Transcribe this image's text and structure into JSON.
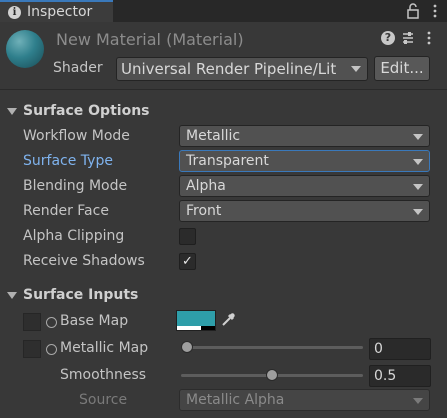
{
  "tab": {
    "label": "Inspector",
    "icon": "info-icon"
  },
  "header": {
    "title": "New Material (Material)",
    "shader_label": "Shader",
    "shader_value": "Universal Render Pipeline/Lit",
    "edit_label": "Edit..."
  },
  "surface_options": {
    "title": "Surface Options",
    "workflow_mode": {
      "label": "Workflow Mode",
      "value": "Metallic"
    },
    "surface_type": {
      "label": "Surface Type",
      "value": "Transparent"
    },
    "blending_mode": {
      "label": "Blending Mode",
      "value": "Alpha"
    },
    "render_face": {
      "label": "Render Face",
      "value": "Front"
    },
    "alpha_clipping": {
      "label": "Alpha Clipping",
      "checked": false
    },
    "receive_shadows": {
      "label": "Receive Shadows",
      "checked": true,
      "check_glyph": "✓"
    }
  },
  "surface_inputs": {
    "title": "Surface Inputs",
    "base_map": {
      "label": "Base Map",
      "color": "#2e9ea9"
    },
    "metallic_map": {
      "label": "Metallic Map",
      "value": "0",
      "fraction": 0
    },
    "smoothness": {
      "label": "Smoothness",
      "value": "0.5",
      "fraction": 0.5
    },
    "source": {
      "label": "Source",
      "value": "Metallic Alpha"
    }
  },
  "colors": {
    "accent": "#3a79bb",
    "active_label": "#7fb3ee",
    "background": "#383838"
  }
}
